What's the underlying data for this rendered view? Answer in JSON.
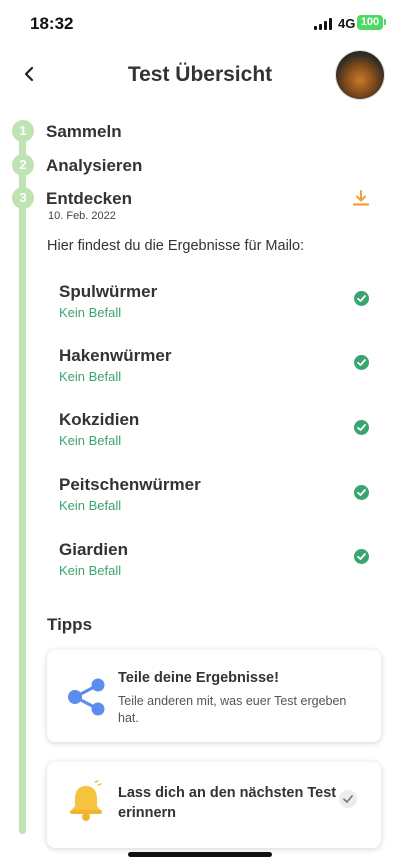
{
  "status_bar": {
    "time": "18:32",
    "network": "4G",
    "battery": "100"
  },
  "header": {
    "title": "Test Übersicht"
  },
  "steps": [
    {
      "number": "1",
      "label": "Sammeln"
    },
    {
      "number": "2",
      "label": "Analysieren"
    },
    {
      "number": "3",
      "label": "Entdecken",
      "date": "10. Feb. 2022"
    }
  ],
  "intro_text": "Hier findest du die Ergebnisse für Mailo:",
  "results": [
    {
      "name": "Spulwürmer",
      "status": "Kein Befall"
    },
    {
      "name": "Hakenwürmer",
      "status": "Kein Befall"
    },
    {
      "name": "Kokzidien",
      "status": "Kein Befall"
    },
    {
      "name": "Peitschenwürmer",
      "status": "Kein Befall"
    },
    {
      "name": "Giardien",
      "status": "Kein Befall"
    }
  ],
  "tips": {
    "title": "Tipps",
    "cards": [
      {
        "icon": "share-icon",
        "title": "Teile deine Ergebnisse!",
        "text": "Teile anderen mit, was euer Test ergeben hat."
      },
      {
        "icon": "bell-icon",
        "title": "Lass dich an den nächsten Test erinnern",
        "text": ""
      }
    ]
  },
  "colors": {
    "accent_green": "#3aa56e",
    "timeline_green": "#bfe3b2",
    "download_orange": "#f0a13a",
    "share_blue": "#5b8def",
    "bell_yellow": "#f6c33f"
  }
}
